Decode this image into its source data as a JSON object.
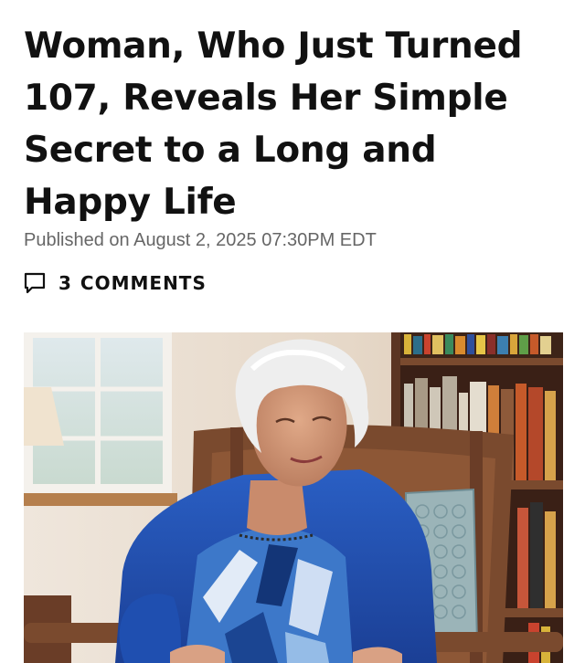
{
  "article": {
    "headline": "Woman, Who Just Turned 107, Reveals Her Simple Secret to a Long and Happy Life",
    "byline": "Published on August 2, 2025 07:30PM EDT",
    "comments": {
      "count": "3",
      "label": "COMMENTS",
      "icon": "comment-bubble-icon"
    },
    "photo": {
      "subject": "elderly woman in blue cardigan seated in wooden chair",
      "colors": {
        "cardigan": "#1f4fb0",
        "hair": "#efefef",
        "chair": "#7a4a2e",
        "wall": "#e8ddd0",
        "shelf": "#5b3522"
      }
    }
  }
}
